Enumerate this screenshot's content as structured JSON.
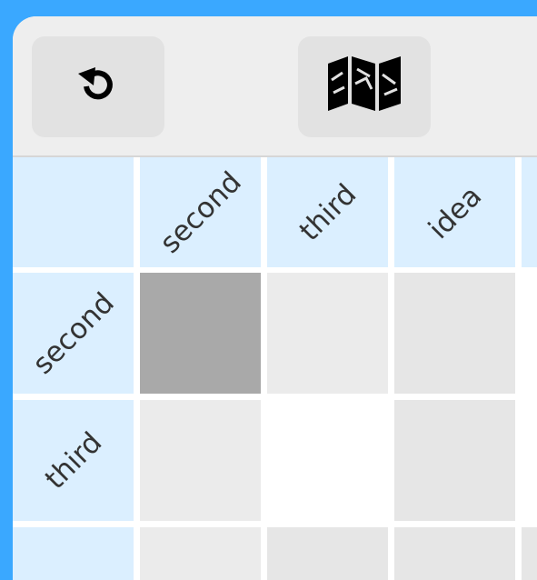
{
  "toolbar": {
    "reset_button": {
      "icon": "rotate-ccw-icon"
    },
    "map_button": {
      "icon": "map-icon"
    }
  },
  "matrix": {
    "column_headers": [
      "second",
      "third",
      "idea"
    ],
    "row_headers": [
      "second",
      "third"
    ],
    "cells": [
      [
        "selected",
        "empty",
        "empty"
      ],
      [
        "empty",
        "blank",
        "empty"
      ]
    ]
  },
  "colors": {
    "background": "#3aa8ff",
    "header": "#dbefff",
    "cell_empty": "#ebebeb",
    "cell_selected": "#a9a9a9",
    "toolbar": "#eeeeee"
  }
}
